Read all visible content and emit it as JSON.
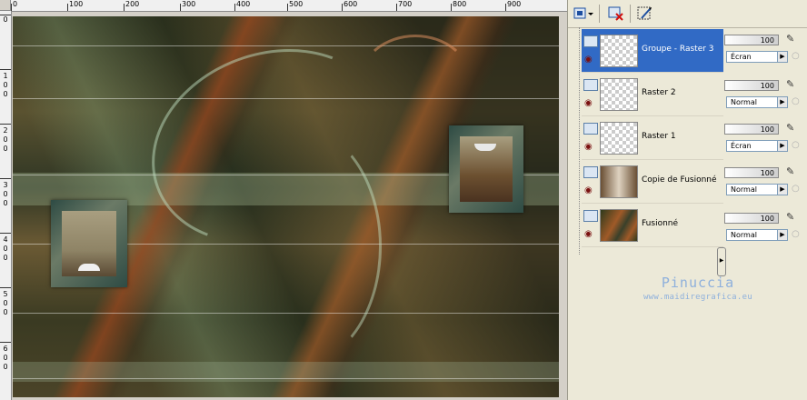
{
  "ruler": {
    "top_labels": [
      "0",
      "100",
      "200",
      "300",
      "400",
      "500",
      "600",
      "700",
      "800",
      "900"
    ],
    "left_labels": [
      "0",
      "1",
      "0",
      "0",
      "2",
      "0",
      "0",
      "3",
      "0",
      "0",
      "4",
      "0",
      "0",
      "5",
      "0",
      "0",
      "6",
      "0",
      "0"
    ]
  },
  "layers_toolbar": {
    "icons": [
      "layer-view-icon",
      "delete-layer-icon",
      "layer-properties-icon"
    ]
  },
  "layers": [
    {
      "name": "Groupe - Raster 3",
      "selected": true,
      "opacity": "100",
      "blend": "Écran"
    },
    {
      "name": "Raster 2",
      "selected": false,
      "opacity": "100",
      "blend": "Normal"
    },
    {
      "name": "Raster 1",
      "selected": false,
      "opacity": "100",
      "blend": "Écran"
    },
    {
      "name": "Copie de Fusionné",
      "selected": false,
      "opacity": "100",
      "blend": "Normal"
    },
    {
      "name": "Fusionné",
      "selected": false,
      "opacity": "100",
      "blend": "Normal"
    }
  ],
  "watermark": {
    "name": "Pinuccia",
    "url": "www.maidiregrafica.eu"
  },
  "colors": {
    "selection": "#316ac5",
    "panel": "#ece9d8",
    "watermark": "#8eb0dc"
  }
}
